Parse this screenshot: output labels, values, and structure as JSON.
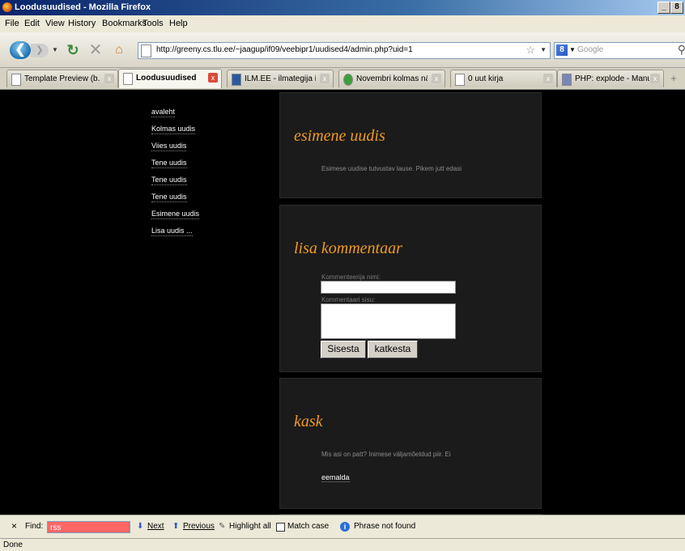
{
  "window": {
    "title": "Loodusuudised - Mozilla Firefox",
    "minimize": "_",
    "maximize": "8"
  },
  "menu": [
    "File",
    "Edit",
    "View",
    "History",
    "Bookmarks",
    "Tools",
    "Help"
  ],
  "nav": {
    "url": "http://greeny.cs.tlu.ee/~jaagup/if09/veebipr1/uudised4/admin.php?uid=1",
    "search_placeholder": "Google"
  },
  "tabs": [
    {
      "label": "Template Preview (b...",
      "active": false
    },
    {
      "label": "Loodusuudised",
      "active": true
    },
    {
      "label": "ILM.EE - ilmategija in...",
      "active": false
    },
    {
      "label": "Novembri kolmas näd...",
      "active": false
    },
    {
      "label": "0 uut kirja",
      "active": false
    },
    {
      "label": "PHP: explode - Manual",
      "active": false
    }
  ],
  "sidebar": {
    "items": [
      "avaleht",
      "Kolmas uudis",
      "Viies uudis",
      "Tene uudis",
      "Tene uudis",
      "Tene uudis",
      "Esimene uudis",
      "Lisa uudis ..."
    ]
  },
  "news": {
    "title": "esimene uudis",
    "text": "Esimese uudise tutvustav lause. Pikem jutt edasi"
  },
  "comment_form": {
    "title": "lisa kommentaar",
    "name_label": "Kommenteerija nimi:",
    "content_label": "Kommentaari sisu:",
    "name_value": "",
    "content_value": "",
    "submit_label": "Sisesta",
    "cancel_label": "katkesta"
  },
  "comment": {
    "title": "kask",
    "text": "Mis asi on patt? Inimese väljamõeldud piir. Ei",
    "delete_label": "eemalda"
  },
  "findbar": {
    "close": "×",
    "find_label": "Find:",
    "query": "rss",
    "next_label": "Next",
    "previous_label": "Previous",
    "highlight_label": "Highlight all",
    "matchcase_label": "Match case",
    "status": "Phrase not found"
  },
  "status": "Done"
}
